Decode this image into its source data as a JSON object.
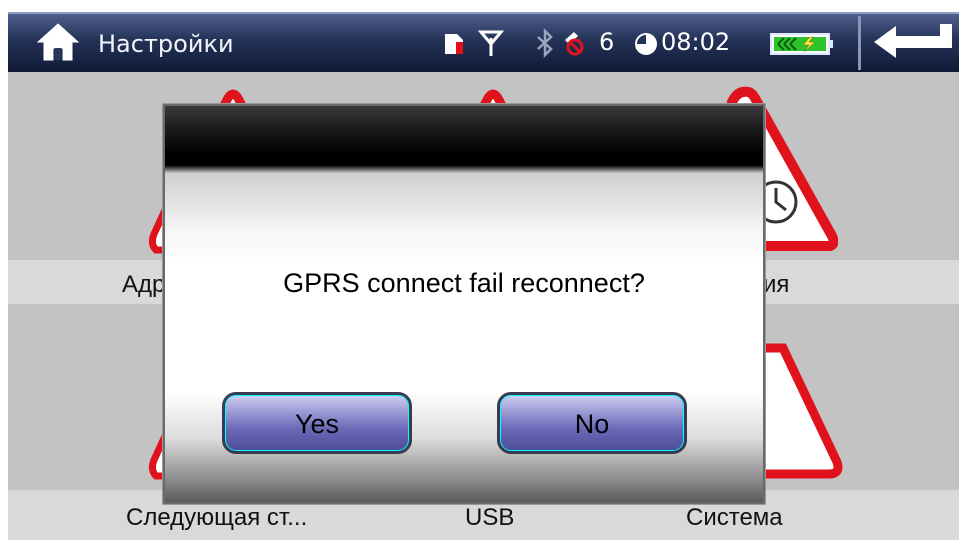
{
  "header": {
    "title": "Настройки",
    "satellite_count": "6",
    "time": "08:02",
    "icons": [
      "home-icon",
      "sim-card-icon",
      "signal-icon",
      "bluetooth-icon",
      "satellite-off-icon",
      "clock-icon",
      "battery-charging-icon",
      "back-arrow-icon"
    ]
  },
  "tiles": {
    "row1": [
      "Адр",
      "ия"
    ],
    "row2": [
      "Следующая ст...",
      "USB",
      "Система"
    ]
  },
  "dialog": {
    "message": "GPRS connect fail reconnect?",
    "yes_label": "Yes",
    "no_label": "No"
  },
  "colors": {
    "accent_red": "#e0121c",
    "header_dark": "#101a36",
    "button_purple": "#6a6ab8",
    "battery_green": "#2cc42c"
  }
}
